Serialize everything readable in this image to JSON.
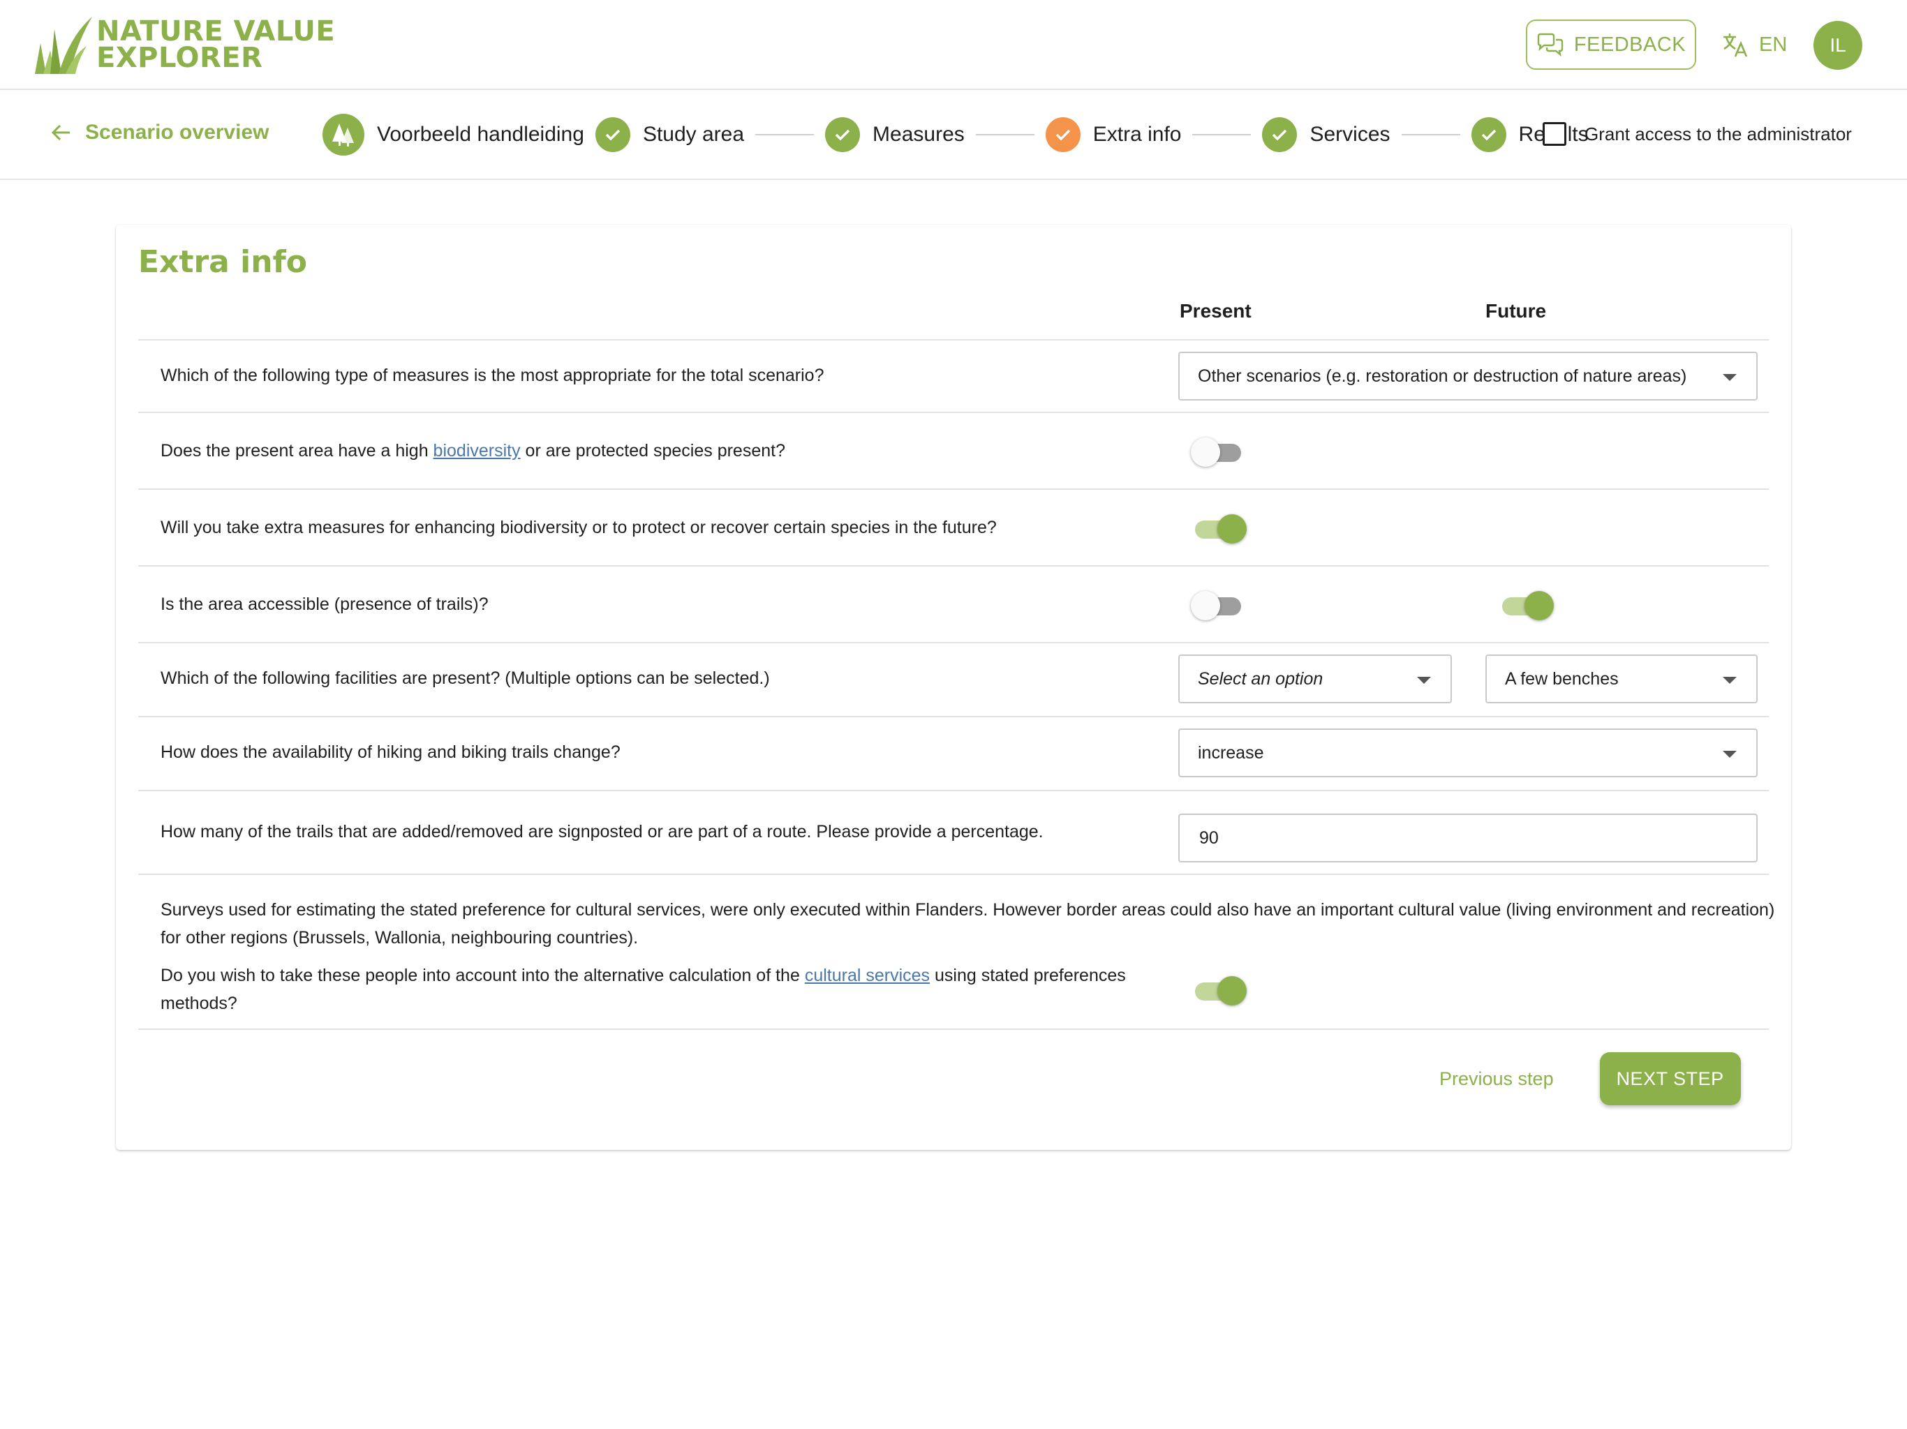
{
  "brand": {
    "line1": "NATURE VALUE",
    "line2": "EXPLORER"
  },
  "header": {
    "feedback_label": "FEEDBACK",
    "language": "EN",
    "user_initials": "IL"
  },
  "stepbar": {
    "back_label": "Scenario overview",
    "scenario_name": "Voorbeeld handleiding",
    "steps": [
      {
        "label": "Study area",
        "status": "complete"
      },
      {
        "label": "Measures",
        "status": "complete"
      },
      {
        "label": "Extra info",
        "status": "current"
      },
      {
        "label": "Services",
        "status": "complete"
      },
      {
        "label": "Results",
        "status": "complete"
      }
    ],
    "grant_label": "Grant access to the administrator",
    "grant_checked": false
  },
  "card": {
    "title": "Extra info",
    "col_present": "Present",
    "col_future": "Future"
  },
  "questions": {
    "q1": {
      "text": "Which of the following type of measures is the most appropriate for the total scenario?",
      "value": "Other scenarios (e.g. restoration or destruction of nature areas)"
    },
    "q2": {
      "before": "Does the present area have a high ",
      "link": "biodiversity",
      "after": " or are protected species present?",
      "present": false
    },
    "q3": {
      "text": "Will you take extra measures for enhancing biodiversity or to protect or recover certain species in the future?",
      "present": true
    },
    "q4": {
      "text": "Is the area accessible (presence of trails)?",
      "present": false,
      "future": true
    },
    "q5": {
      "text": "Which of the following facilities are present? (Multiple options can be selected.)",
      "present_placeholder": "Select an option",
      "future_value": "A few benches"
    },
    "q6": {
      "text": "How does the availability of hiking and biking trails change?",
      "value": "increase"
    },
    "q7": {
      "text": "How many of the trails that are added/removed are signposted or are part of a route. Please provide a percentage.",
      "value": "90"
    },
    "q8": {
      "note": "Surveys used for estimating the stated preference for cultural services, were only executed within Flanders. However border areas could also have an important cultural value (living environment and recreation) for other regions (Brussels, Wallonia, neighbouring countries).",
      "before": "Do you wish to take these people into account into the alternative calculation of the ",
      "link": "cultural services",
      "after": " using stated preferences methods?",
      "present": true
    }
  },
  "actions": {
    "previous_label": "Previous step",
    "next_label": "NEXT STEP"
  },
  "colors": {
    "brand_green": "#8cb04a",
    "current_step_orange": "#f4934a",
    "link_blue": "#4a78a8"
  },
  "icons": {
    "back": "arrow-left-icon",
    "feedback": "chat-bubbles-icon",
    "language": "translate-icon",
    "check": "check-icon",
    "scenario": "trees-icon",
    "dropdown": "caret-down-icon"
  }
}
